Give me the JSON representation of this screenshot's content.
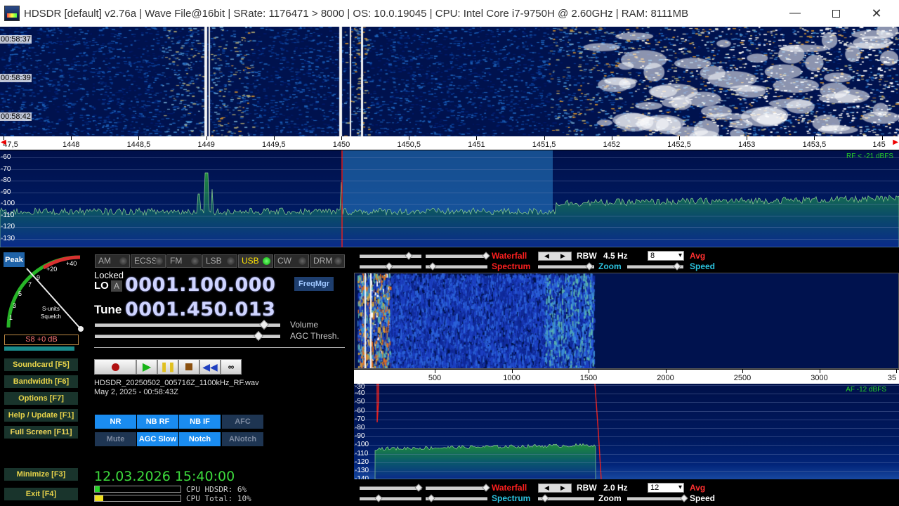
{
  "window": {
    "title": "HDSDR  [default]  v2.76a  |  Wave File@16bit  |  SRate: 1176471 > 8000  |  OS: 10.0.19045    |  CPU: Intel Core i7-9750H @ 2.60GHz  |  RAM: 8111MB"
  },
  "waterfall_top": {
    "times": [
      "00:58:37",
      "00:58:39",
      "00:58:42"
    ]
  },
  "freq_scale_top": {
    "labels": [
      "47,5",
      "1448",
      "1448,5",
      "1449",
      "1449,5",
      "1450",
      "1450,5",
      "1451",
      "1451,5",
      "1452",
      "1452,5",
      "1453",
      "1453,5",
      "145"
    ]
  },
  "spectrum_top": {
    "db_labels": [
      "-60",
      "-70",
      "-80",
      "-90",
      "-100",
      "-110",
      "-120",
      "-130"
    ],
    "rf_level": "RF < -21 dBFS"
  },
  "smeter": {
    "peak_label": "Peak",
    "scale_labels": [
      "1",
      "3",
      "5",
      "7",
      "9",
      "+20",
      "+40"
    ],
    "s_units_label": "S-units",
    "squelch_label": "Squelch",
    "readout": "S8 +0 dB"
  },
  "modes": [
    {
      "label": "AM",
      "active": false
    },
    {
      "label": "ECSS",
      "active": false
    },
    {
      "label": "FM",
      "active": false
    },
    {
      "label": "LSB",
      "active": false
    },
    {
      "label": "USB",
      "active": true
    },
    {
      "label": "CW",
      "active": false
    },
    {
      "label": "DRM",
      "active": false
    }
  ],
  "lo": {
    "locked_label": "Locked",
    "lo_label": "LO",
    "lo_a": "A",
    "lo_freq": "0001.100.000",
    "tune_label": "Tune",
    "tune_freq": "0001.450.013",
    "freqmgr_label": "FreqMgr"
  },
  "sliders": {
    "volume_label": "Volume",
    "agc_label": "AGC Thresh."
  },
  "nav_buttons": {
    "soundcard": "Soundcard  [F5]",
    "bandwidth": "Bandwidth  [F6]",
    "options": "Options    [F7]",
    "help": "Help / Update  [F1]",
    "fullscreen": "Full Screen  [F11]",
    "minimize": "Minimize  [F3]",
    "exit": "Exit      [F4]"
  },
  "recording": {
    "filename": "HDSDR_20250502_005716Z_1100kHz_RF.wav",
    "date": "May 2, 2025 - 00:58:43Z"
  },
  "dsp": {
    "nr": "NR",
    "nb_rf": "NB RF",
    "nb_if": "NB IF",
    "afc": "AFC",
    "mute": "Mute",
    "agc_slow": "AGC Slow",
    "notch": "Notch",
    "anotch": "ANotch"
  },
  "status": {
    "clock": "12.03.2026 15:40:00",
    "cpu_hdsdr": "CPU HDSDR:  6%",
    "cpu_total": "CPU Total: 10%",
    "cpu_hdsdr_value": 0.06,
    "cpu_total_value": 0.1
  },
  "rf_controls": {
    "waterfall_label": "Waterfall",
    "spectrum_label": "Spectrum",
    "rbw_label": "RBW",
    "rbw_value": "4.5 Hz",
    "zoom_label": "Zoom",
    "avg_label": "Avg",
    "speed_label": "Speed",
    "select_value": "8"
  },
  "af_scale": {
    "labels": [
      "500",
      "1000",
      "1500",
      "2000",
      "2500",
      "3000",
      "35"
    ]
  },
  "af_spectrum": {
    "db_labels": [
      "-30",
      "-40",
      "-50",
      "-60",
      "-70",
      "-80",
      "-90",
      "-100",
      "-110",
      "-120",
      "-130",
      "-140"
    ],
    "af_level": "AF -12 dBFS"
  },
  "af_controls": {
    "waterfall_label": "Waterfall",
    "spectrum_label": "Spectrum",
    "rbw_label": "RBW",
    "rbw_value": "2.0 Hz",
    "zoom_label": "Zoom",
    "avg_label": "Avg",
    "speed_label": "Speed",
    "select_value": "12"
  },
  "colors": {
    "accent_green": "#3ddb3d",
    "waterfall_red": "#ff2020",
    "spectrum_cyan": "#2cc4e0",
    "avg_red": "#ff3030",
    "active_blue": "#1a8cf0"
  }
}
